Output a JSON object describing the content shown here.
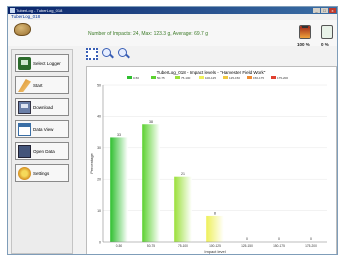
{
  "window": {
    "title": "TuberLog - TuberLog_018",
    "controls": [
      "_",
      "□",
      "x"
    ]
  },
  "menu": {
    "label": "TuberLog_018"
  },
  "header": {
    "summary": "Number of Impacts: 24, Max: 123.3 g, Average: 69.7 g",
    "gauges": [
      {
        "name": "battery",
        "value_pct": 100,
        "label": "100 %"
      },
      {
        "name": "memory",
        "value_pct": 0,
        "label": "0 %"
      }
    ]
  },
  "sidebar": {
    "buttons": [
      {
        "id": "select-logger",
        "label": "Select Logger",
        "icon": "logger-icon"
      },
      {
        "id": "start",
        "label": "Start",
        "icon": "start-icon"
      },
      {
        "id": "download",
        "label": "Download",
        "icon": "download-icon"
      },
      {
        "id": "data-view",
        "label": "Data View",
        "icon": "data-view-icon"
      },
      {
        "id": "open-data",
        "label": "Open Data",
        "icon": "open-data-icon"
      },
      {
        "id": "settings",
        "label": "Settings",
        "icon": "settings-icon"
      }
    ]
  },
  "toolbar": {
    "tools": [
      "expand-icon",
      "zoom-in-icon",
      "zoom-out-icon"
    ]
  },
  "chart_data": {
    "type": "bar",
    "title": "TuberLog_018 - Impact levels - \"Harvester Field Work\"",
    "ylabel": "Percentage",
    "xlabel": "Impact level",
    "ylim": [
      0,
      50
    ],
    "yticks": [
      0,
      10,
      20,
      30,
      40,
      50
    ],
    "grid": true,
    "legend_position": "top",
    "legend": [
      "0-50",
      "50-75",
      "75-100",
      "100-125",
      "125-150",
      "150-175",
      "175-200"
    ],
    "categories": [
      "0-50",
      "50-75",
      "75-100",
      "100-125",
      "125-150",
      "150-175",
      "175-200"
    ],
    "values": [
      33.3,
      37.5,
      20.8,
      8.3,
      0,
      0,
      0
    ],
    "data_labels": [
      "33",
      "38",
      "21",
      "8",
      "0",
      "0",
      "0"
    ],
    "colors": [
      "#2fbf2f",
      "#5bd12f",
      "#9be03a",
      "#eef05a",
      "#f0c840",
      "#f08a30",
      "#e04030"
    ]
  }
}
